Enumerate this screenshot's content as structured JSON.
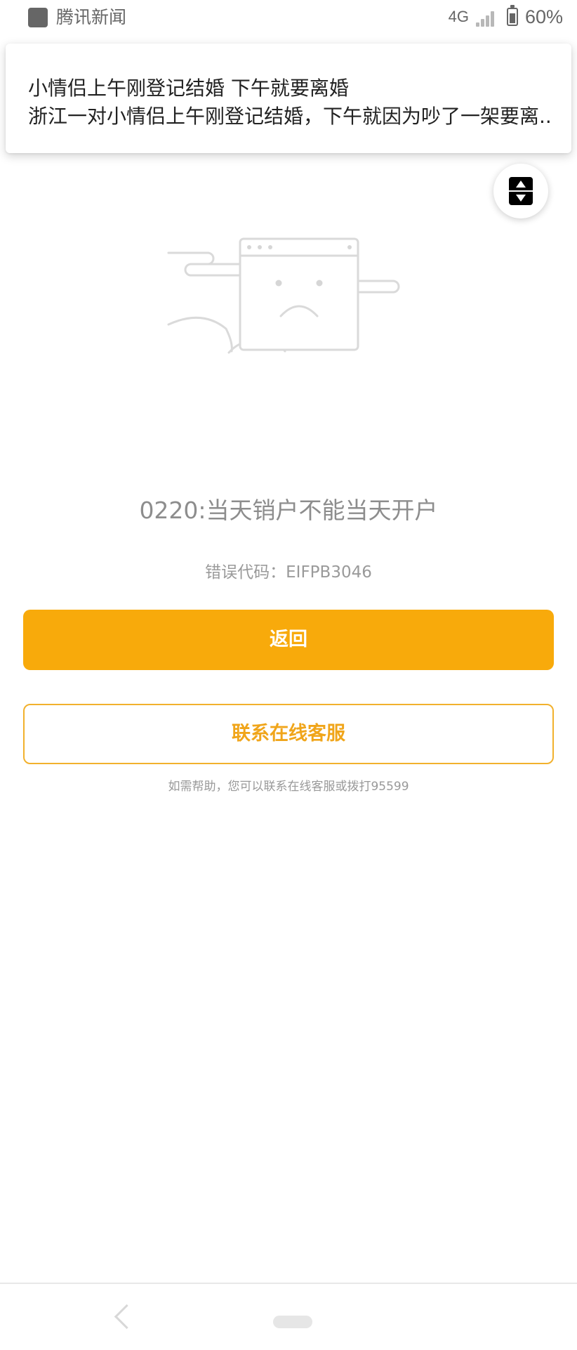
{
  "status_bar": {
    "app_name": "腾讯新闻",
    "network": "4G",
    "battery": "60%"
  },
  "notification": {
    "title": "小情侣上午刚登记结婚 下午就要离婚",
    "body": "浙江一对小情侣上午刚登记结婚，下午就因为吵了一架要离.."
  },
  "error": {
    "title": "0220:当天销户不能当天开户",
    "code": "错误代码：EIFPB3046"
  },
  "buttons": {
    "back": "返回",
    "service": "联系在线客服"
  },
  "help_text": "如需帮助，您可以联系在线客服或拨打95599",
  "colors": {
    "accent": "#f8aa0b",
    "outline": "#f2b12d"
  }
}
